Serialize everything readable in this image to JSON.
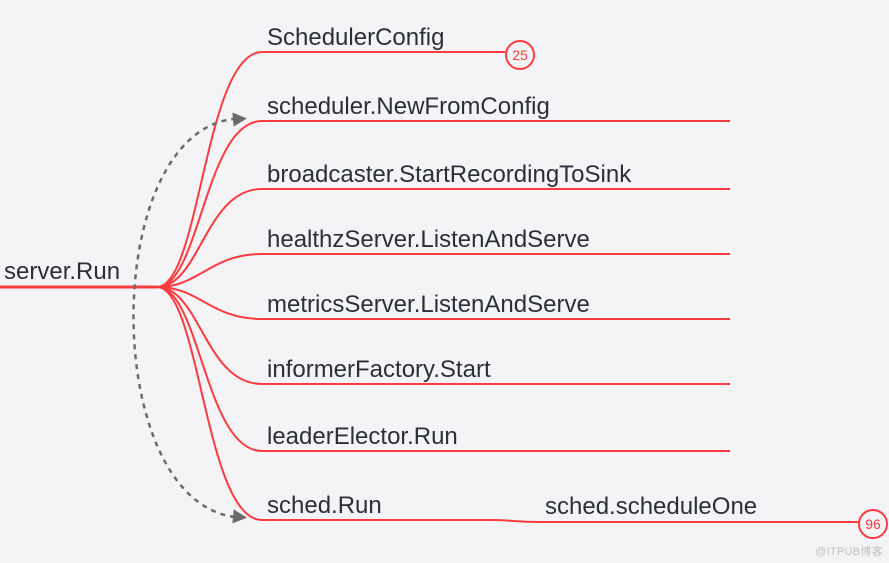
{
  "root": {
    "label": "server.Run"
  },
  "branches": [
    {
      "label": "SchedulerConfig",
      "badge": "25"
    },
    {
      "label": "scheduler.NewFromConfig"
    },
    {
      "label": "broadcaster.StartRecordingToSink"
    },
    {
      "label": "healthzServer.ListenAndServe"
    },
    {
      "label": "metricsServer.ListenAndServe"
    },
    {
      "label": "informerFactory.Start"
    },
    {
      "label": "leaderElector.Run"
    },
    {
      "label": "sched.Run"
    }
  ],
  "child3": {
    "label": "sched.scheduleOne",
    "badge": "96"
  },
  "watermark": "@ITPUB博客"
}
